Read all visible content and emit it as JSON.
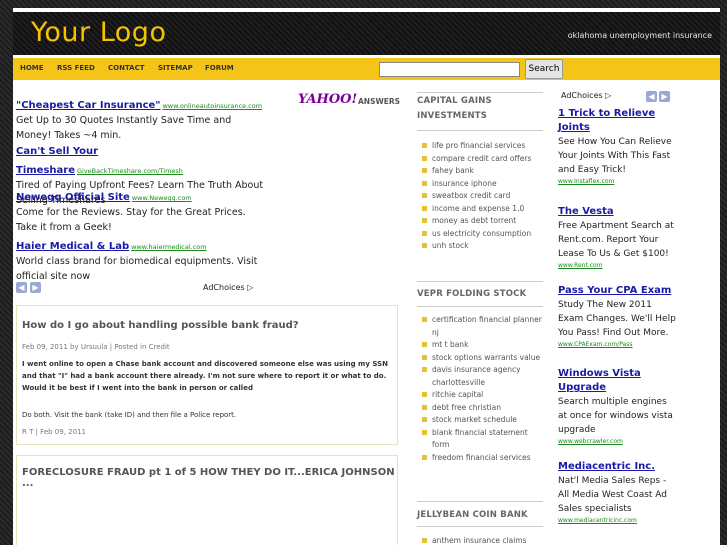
{
  "header": {
    "logo": "Your Logo",
    "tagline": "oklahoma unemployment insurance"
  },
  "nav": {
    "items": [
      "HOME",
      "RSS FEED",
      "CONTACT",
      "SITEMAP",
      "FORUM"
    ],
    "search_value": "",
    "search_button": "Search"
  },
  "left_ads": [
    {
      "title": "\"Cheapest Car Insurance\"",
      "url": "www.onlineautoinsurance.com",
      "desc": "Get Up to 30 Quotes Instantly Save Time and Money! Takes ~4 min."
    },
    {
      "title": "Can't Sell Your Timeshare",
      "url": "GiveBackTimeshare.com/Timesh",
      "desc": "Tired of Paying Upfront Fees? Learn The Truth About Selling Timeshares"
    },
    {
      "title": "Newegg Official Site",
      "url": "www.Newegg.com",
      "desc": "Come for the Reviews. Stay for the Great Prices. Take it from a Geek!"
    },
    {
      "title": "Haier Medical & Lab",
      "url": "www.haiermedical.com",
      "desc": "World class brand for biomedical equipments. Visit official site now"
    }
  ],
  "yahoo": {
    "logo": "YAHOO!",
    "answers": "ANSWERS"
  },
  "adchoices": "AdChoices",
  "post1": {
    "title": "How do I go about handling possible bank fraud?",
    "meta": "Feb 09, 2011 by Ursuula | Posted in Credit",
    "question": "I went online to open a Chase bank account and discovered someone else was using my SSN and that \"I\" had a bank account there already. I'm not sure where to report it or what to do. Would it be best if I went into the bank in person or called",
    "answer": "Do both. Visit the bank (take ID) and then file a Police report.",
    "answer_meta": "R T | Feb 09, 2011"
  },
  "post2": {
    "title": "FORECLOSURE FRAUD pt 1 of 5 HOW THEY DO IT...ERICA JOHNSON ..."
  },
  "middle": {
    "sections": [
      {
        "heading": "CAPITAL GAINS INVESTMENTS",
        "items": [
          "life pro financial services",
          "compare credit card offers",
          "fahey bank",
          "insurance iphone",
          "sweatbox credit card",
          "income and expense 1.0",
          "money as debt torrent",
          "us electricity consumption",
          "unh stock"
        ]
      },
      {
        "heading": "VEPR FOLDING STOCK",
        "items": [
          "certification financial planner nj",
          "mt t bank",
          "stock options warrants value",
          "davis insurance agency charlottesville",
          "ritchie capital",
          "debt free christian",
          "stock market schedule",
          "blank financial statement form",
          "freedom financial services"
        ]
      },
      {
        "heading": "JELLYBEAN COIN BANK",
        "items": [
          "anthem insurance claims"
        ]
      }
    ]
  },
  "right_ads": [
    {
      "title": "1 Trick to Relieve Joints",
      "desc": "See How You Can Relieve Your Joints With This Fast and Easy Trick!",
      "url": "www.Instaflex.com"
    },
    {
      "title": "The Vesta",
      "desc": "Free Apartment Search at Rent.com. Report Your Lease To Us & Get $100!",
      "url": "www.Rent.com"
    },
    {
      "title": "Pass Your CPA Exam",
      "desc": "Study The New 2011 Exam Changes. We'll Help You Pass! Find Out More.",
      "url": "www.CPAExam.com/Pass"
    },
    {
      "title": "Windows Vista Upgrade",
      "desc": "Search multiple engines at once for windows vista upgrade",
      "url": "www.webcrawler.com"
    },
    {
      "title": "Mediacentric Inc.",
      "desc": "Nat'l Media Sales Reps - All Media West Coast Ad Sales specialists",
      "url": "www.mediacentricinc.com"
    }
  ],
  "icons": {
    "prev": "chevron-left-icon",
    "next": "chevron-right-icon",
    "adchoices": "adchoices-icon"
  },
  "colors": {
    "accent": "#f4c518",
    "link": "#1a1aa8",
    "url": "#1a8a1a"
  }
}
